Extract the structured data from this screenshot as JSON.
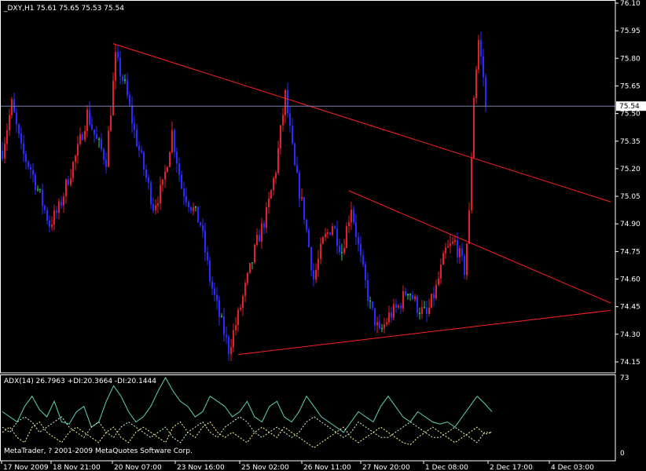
{
  "colors": {
    "background": "#000000",
    "frame": "#ffffff",
    "bull": "#e0202a",
    "bear": "#2b2bff",
    "doji": "#2fd15a",
    "trendline": "#ff2020",
    "bid_line": "#8080a8",
    "adx": "#5fd3b8",
    "plus_di": "#ffff9a",
    "minus_di": "#c8ffc8"
  },
  "main_header": "_DXY,H1  75.61 75.65 75.53 75.54",
  "indicator_header": "ADX(14) 26.7963 +DI:20.3664 -DI:20.1444",
  "copyright": "MetaTrader, ? 2001-2009 MetaQuotes Software Corp.",
  "current_price_label": "75.54",
  "chart_data": [
    {
      "type": "candlestick",
      "symbol": "_DXY",
      "timeframe": "H1",
      "ohlc_last": {
        "open": 75.61,
        "high": 75.65,
        "low": 75.53,
        "close": 75.54
      },
      "ylim": [
        74.1,
        76.1
      ],
      "y_ticks": [
        "76.10",
        "75.95",
        "75.80",
        "75.65",
        "75.50",
        "75.35",
        "75.20",
        "75.05",
        "74.90",
        "74.75",
        "74.60",
        "74.45",
        "74.30",
        "74.15"
      ],
      "x_ticks": [
        "17 Nov 2009",
        "18 Nov 21:00",
        "20 Nov 07:00",
        "23 Nov 16:00",
        "25 Nov 02:00",
        "26 Nov 11:00",
        "27 Nov 20:00",
        "1 Dec 08:00",
        "2 Dec 17:00",
        "4 Dec 03:00"
      ],
      "current_price": 75.54,
      "price_path_bar_count": 206,
      "price_path": [
        [
          0,
          75.3
        ],
        [
          4,
          75.55
        ],
        [
          8,
          75.3
        ],
        [
          12,
          75.2
        ],
        [
          16,
          75.05
        ],
        [
          20,
          74.9
        ],
        [
          24,
          74.98
        ],
        [
          28,
          75.15
        ],
        [
          32,
          75.3
        ],
        [
          36,
          75.5
        ],
        [
          40,
          75.35
        ],
        [
          44,
          75.25
        ],
        [
          48,
          75.8
        ],
        [
          52,
          75.65
        ],
        [
          56,
          75.4
        ],
        [
          60,
          75.2
        ],
        [
          64,
          75.0
        ],
        [
          68,
          75.1
        ],
        [
          72,
          75.4
        ],
        [
          76,
          75.1
        ],
        [
          80,
          75.0
        ],
        [
          84,
          74.9
        ],
        [
          88,
          74.6
        ],
        [
          92,
          74.4
        ],
        [
          96,
          74.22
        ],
        [
          100,
          74.4
        ],
        [
          104,
          74.6
        ],
        [
          108,
          74.8
        ],
        [
          112,
          74.95
        ],
        [
          116,
          75.2
        ],
        [
          120,
          75.6
        ],
        [
          124,
          75.2
        ],
        [
          128,
          74.95
        ],
        [
          132,
          74.6
        ],
        [
          136,
          74.8
        ],
        [
          140,
          74.9
        ],
        [
          144,
          74.75
        ],
        [
          148,
          75.0
        ],
        [
          152,
          74.7
        ],
        [
          156,
          74.45
        ],
        [
          160,
          74.3
        ],
        [
          164,
          74.4
        ],
        [
          168,
          74.45
        ],
        [
          172,
          74.55
        ],
        [
          176,
          74.45
        ],
        [
          180,
          74.4
        ],
        [
          184,
          74.55
        ],
        [
          188,
          74.75
        ],
        [
          192,
          74.8
        ],
        [
          196,
          74.65
        ],
        [
          198,
          74.95
        ],
        [
          200,
          75.6
        ],
        [
          202,
          75.9
        ],
        [
          204,
          75.7
        ],
        [
          205,
          75.54
        ]
      ],
      "trendlines": [
        {
          "from": {
            "bar": 47,
            "price": 75.88
          },
          "to": {
            "bar": 258,
            "price": 75.02
          }
        },
        {
          "from": {
            "bar": 100,
            "price": 74.19
          },
          "to": {
            "bar": 258,
            "price": 74.43
          }
        },
        {
          "from": {
            "bar": 147,
            "price": 75.08
          },
          "to": {
            "bar": 258,
            "price": 74.47
          }
        }
      ]
    },
    {
      "type": "line",
      "indicator": "ADX(14)",
      "ylim": [
        0,
        73
      ],
      "y_ticks": [
        "73",
        "0"
      ],
      "series": [
        {
          "name": "ADX(14)",
          "values": [
            40,
            35,
            30,
            45,
            55,
            42,
            35,
            50,
            30,
            28,
            40,
            45,
            25,
            30,
            50,
            65,
            55,
            40,
            30,
            35,
            45,
            60,
            73,
            60,
            50,
            45,
            35,
            40,
            55,
            50,
            45,
            35,
            40,
            50,
            35,
            30,
            45,
            50,
            35,
            30,
            40,
            55,
            45,
            35,
            30,
            25,
            20,
            30,
            40,
            35,
            30,
            45,
            55,
            45,
            35,
            30,
            40,
            35,
            30,
            28,
            30,
            25,
            35,
            45,
            55,
            48,
            40
          ]
        },
        {
          "name": "+DI",
          "values": [
            20,
            25,
            15,
            10,
            25,
            30,
            20,
            15,
            10,
            20,
            25,
            20,
            15,
            10,
            20,
            25,
            15,
            10,
            20,
            25,
            20,
            15,
            10,
            25,
            30,
            20,
            15,
            25,
            30,
            20,
            15,
            20,
            15,
            10,
            20,
            25,
            20,
            15,
            25,
            20,
            15,
            10,
            5,
            10,
            15,
            20,
            25,
            15,
            10,
            15,
            20,
            25,
            20,
            15,
            10,
            8,
            15,
            20,
            25,
            20,
            15,
            10,
            15,
            20,
            25,
            18,
            20
          ]
        },
        {
          "name": "-DI",
          "values": [
            25,
            20,
            30,
            35,
            30,
            20,
            25,
            30,
            35,
            25,
            20,
            15,
            25,
            30,
            20,
            15,
            25,
            30,
            25,
            20,
            15,
            20,
            25,
            15,
            10,
            20,
            25,
            30,
            20,
            15,
            25,
            30,
            35,
            30,
            20,
            15,
            20,
            25,
            20,
            15,
            20,
            30,
            35,
            30,
            25,
            20,
            15,
            20,
            30,
            25,
            20,
            15,
            15,
            20,
            25,
            30,
            25,
            20,
            15,
            15,
            20,
            25,
            20,
            15,
            10,
            20,
            20
          ]
        }
      ]
    }
  ]
}
